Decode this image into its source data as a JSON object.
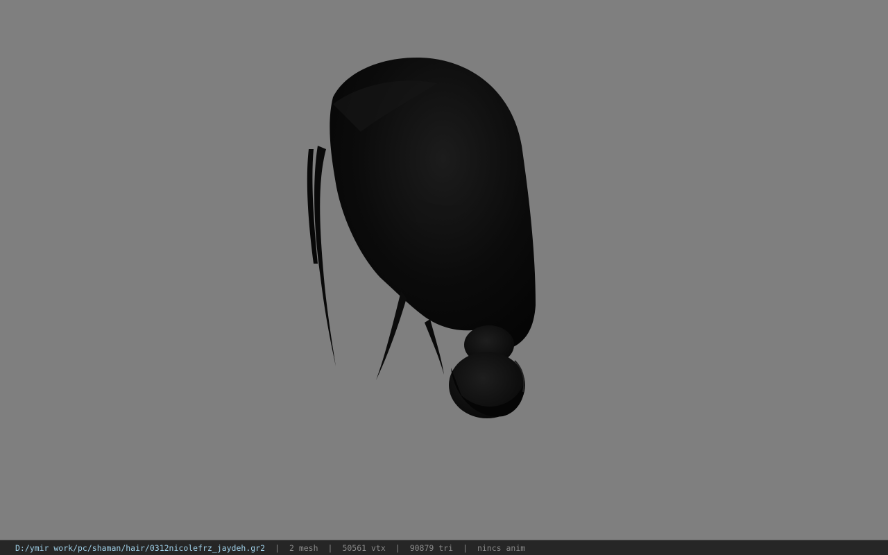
{
  "viewport": {
    "background_color": "#7f7f7f",
    "model_icon": "hair-mesh-icon"
  },
  "statusbar": {
    "file_path": "D:/ymir work/pc/shaman/hair/0312nicolefrz_jaydeh.gr2",
    "separator": "|",
    "mesh_count": "2 mesh",
    "vertex_count": "50561 vtx",
    "triangle_count": "90879 tri",
    "anim_status": "nincs anim",
    "path_color": "#9fd0e8",
    "text_color": "#8a8a8a"
  }
}
